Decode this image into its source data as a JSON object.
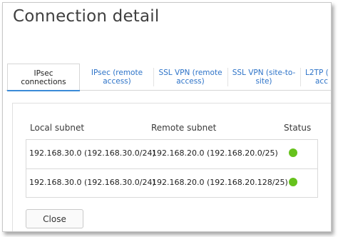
{
  "dialog": {
    "title": "Connection detail"
  },
  "tabs": [
    {
      "line1": "IPsec",
      "line2": "connections",
      "active": true
    },
    {
      "line1": "IPsec (remote",
      "line2": "access)",
      "active": false
    },
    {
      "line1": "SSL VPN (remote",
      "line2": "access)",
      "active": false
    },
    {
      "line1": "SSL VPN (site-to-",
      "line2": "site)",
      "active": false
    },
    {
      "line1": "L2TP (",
      "line2": "acc",
      "active": false
    }
  ],
  "table": {
    "columns": [
      "Local subnet",
      "Remote subnet",
      "Status"
    ],
    "rows": [
      {
        "local": "192.168.30.0 (192.168.30.0/24)",
        "remote": "192.168.20.0 (192.168.20.0/25)",
        "status": "connected"
      },
      {
        "local": "192.168.30.0 (192.168.30.0/24)",
        "remote": "192.168.20.0 (192.168.20.128/25)",
        "status": "connected"
      }
    ],
    "status_color": "#66c21c"
  },
  "buttons": {
    "close": "Close"
  },
  "colors": {
    "accent": "#3b8bd8",
    "tab_link": "#2d73c8"
  }
}
